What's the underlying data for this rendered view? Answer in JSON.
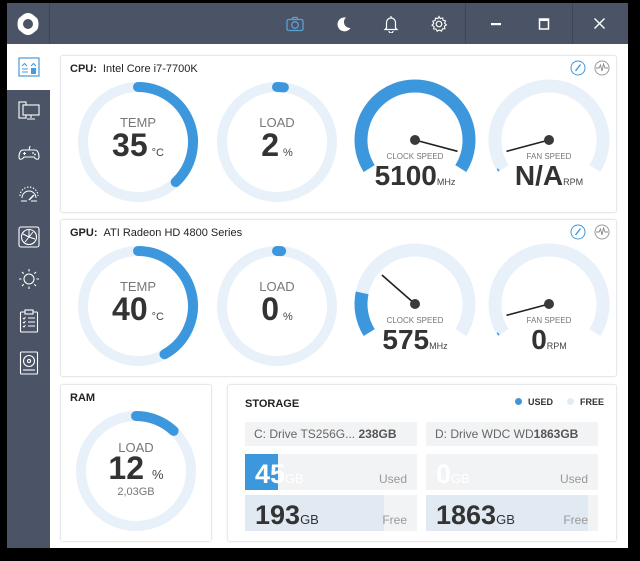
{
  "colors": {
    "accent": "#3d97dd",
    "track": "#e8f1fa",
    "titlebar": "#4a5466",
    "free_bar": "#e1e9f2"
  },
  "titlebar": {
    "icons": [
      "app-logo",
      "camera-icon",
      "moon-icon",
      "bell-icon",
      "gear-icon",
      "minimize-icon",
      "maximize-icon",
      "close-icon"
    ]
  },
  "sidebar": {
    "items": [
      {
        "icon": "dashboard-icon",
        "active": true
      },
      {
        "icon": "monitor-icon",
        "active": false
      },
      {
        "icon": "gamepad-icon",
        "active": false
      },
      {
        "icon": "speedometer-icon",
        "active": false
      },
      {
        "icon": "fan-icon",
        "active": false
      },
      {
        "icon": "brightness-icon",
        "active": false
      },
      {
        "icon": "clipboard-list-icon",
        "active": false
      },
      {
        "icon": "disk-icon",
        "active": false
      }
    ]
  },
  "cpu": {
    "label": "CPU:",
    "name": "Intel Core i7-7700K",
    "temp": {
      "label": "TEMP",
      "value": "35",
      "unit": "°C",
      "fraction": 0.38
    },
    "load": {
      "label": "LOAD",
      "value": "2",
      "unit": "%",
      "fraction": 0.02
    },
    "clock": {
      "label": "CLOCK SPEED",
      "value": "5100",
      "unit": "MHz",
      "fraction": 1.0,
      "needle": 0.93
    },
    "fan": {
      "label": "FAN SPEED",
      "value": "N/A",
      "unit": "RPM",
      "fraction": 0.0,
      "needle": 0.07
    }
  },
  "gpu": {
    "label": "GPU:",
    "name": "ATI Radeon HD 4800 Series",
    "temp": {
      "label": "TEMP",
      "value": "40",
      "unit": "°C",
      "fraction": 0.42
    },
    "load": {
      "label": "LOAD",
      "value": "0",
      "unit": "%",
      "fraction": 0.0
    },
    "clock": {
      "label": "CLOCK SPEED",
      "value": "575",
      "unit": "MHz",
      "fraction": 0.18,
      "needle": 0.3
    },
    "fan": {
      "label": "FAN SPEED",
      "value": "0",
      "unit": "RPM",
      "fraction": 0.0,
      "needle": 0.07
    }
  },
  "ram": {
    "title": "RAM",
    "label": "LOAD",
    "value": "12",
    "unit": "%",
    "sub": "2,03GB",
    "fraction": 0.12
  },
  "storage": {
    "title": "STORAGE",
    "legend_used": "USED",
    "legend_free": "FREE",
    "drives": [
      {
        "name": "C: Drive TS256G...",
        "size": "238GB",
        "used": "45",
        "used_unit": "GB",
        "used_label": "Used",
        "free": "193",
        "free_unit": "GB",
        "free_label": "Free",
        "used_fraction": 0.19,
        "free_fraction": 0.81
      },
      {
        "name": "D: Drive WDC WD",
        "size": "1863GB",
        "used": "0",
        "used_unit": "GB",
        "used_label": "Used",
        "free": "1863",
        "free_unit": "GB",
        "free_label": "Free",
        "used_fraction": 0.0,
        "free_fraction": 0.94
      }
    ]
  }
}
